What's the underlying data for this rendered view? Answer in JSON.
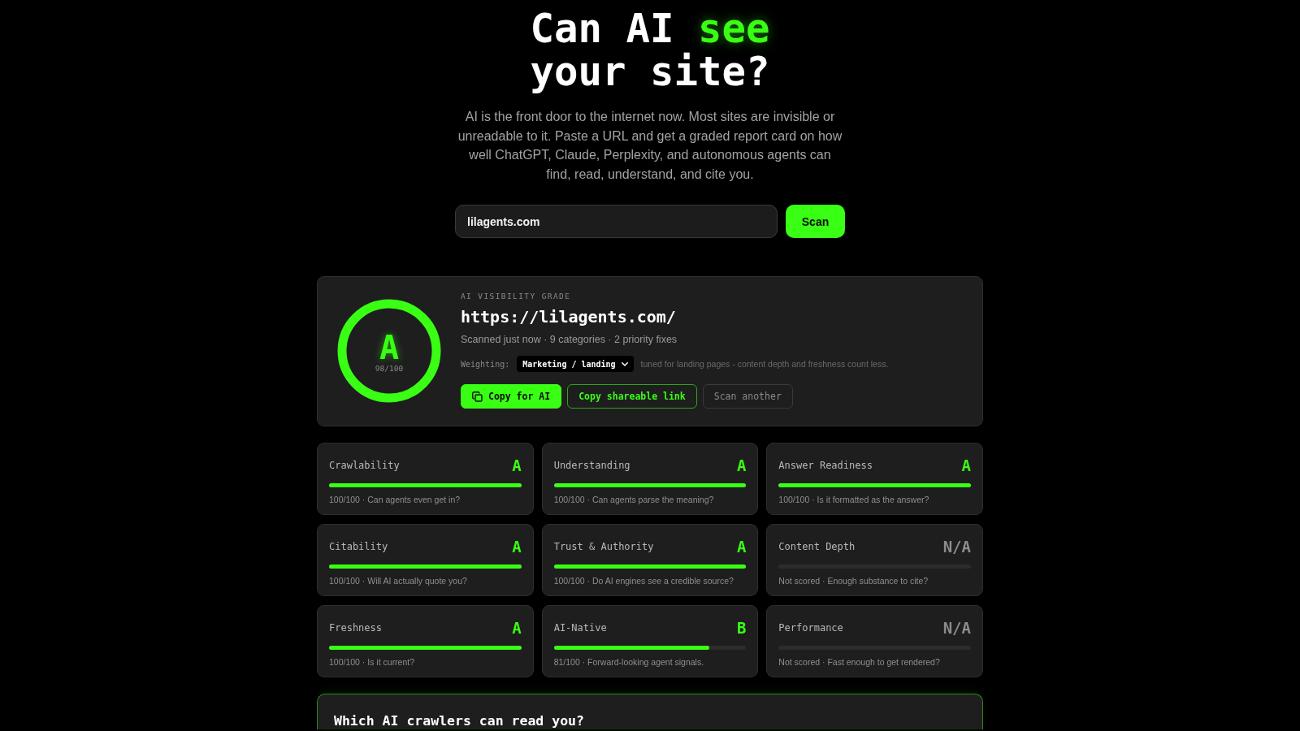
{
  "hero": {
    "title": [
      {
        "text": "Can AI ",
        "highlight": false
      },
      {
        "text": "see",
        "highlight": true
      },
      {
        "text": " your site?",
        "highlight": false
      }
    ],
    "description": "AI is the front door to the internet now. Most sites are invisible or unreadable to it. Paste a URL and get a graded report card on how well ChatGPT, Claude, Perplexity, and autonomous agents can find, read, understand, and cite you."
  },
  "search": {
    "value": "lilagents.com",
    "button": "Scan"
  },
  "grade_card": {
    "eyebrow": "AI VISIBILITY GRADE",
    "grade": "A",
    "score": "98/100",
    "url": "https://lilagents.com/",
    "meta": "Scanned just now · 9 categories · 2 priority fixes",
    "weighting_label": "Weighting:",
    "weighting_value": "Marketing / landing",
    "weighting_note": "tuned for landing pages - content depth and freshness count less.",
    "actions": [
      {
        "label": "Copy for AI",
        "kind": "primary"
      },
      {
        "label": "Copy shareable link",
        "kind": "outline"
      },
      {
        "label": "Scan another",
        "kind": "secondary"
      }
    ]
  },
  "categories": [
    {
      "name": "Crawlability",
      "grade": "A",
      "scored": true,
      "level": 1,
      "detail": "100/100 · Can agents even get in?"
    },
    {
      "name": "Understanding",
      "grade": "A",
      "scored": true,
      "level": 1,
      "detail": "100/100 · Can agents parse the meaning?"
    },
    {
      "name": "Answer Readiness",
      "grade": "A",
      "scored": true,
      "level": 1,
      "detail": "100/100 · Is it formatted as the answer?"
    },
    {
      "name": "Citability",
      "grade": "A",
      "scored": true,
      "level": 1,
      "detail": "100/100 · Will AI actually quote you?"
    },
    {
      "name": "Trust & Authority",
      "grade": "A",
      "scored": true,
      "level": 1,
      "detail": "100/100 · Do AI engines see a credible source?"
    },
    {
      "name": "Content Depth",
      "grade": "N/A",
      "scored": false,
      "detail": "Not scored · Enough substance to cite?"
    },
    {
      "name": "Freshness",
      "grade": "A",
      "scored": true,
      "level": 1,
      "detail": "100/100 · Is it current?"
    },
    {
      "name": "AI-Native",
      "grade": "B",
      "scored": true,
      "level": 0.81,
      "detail": "81/100 · Forward-looking agent signals."
    },
    {
      "name": "Performance",
      "grade": "N/A",
      "scored": false,
      "detail": "Not scored · Fast enough to get rendered?"
    }
  ],
  "crawlers": {
    "title": "Which AI crawlers can read you?"
  }
}
